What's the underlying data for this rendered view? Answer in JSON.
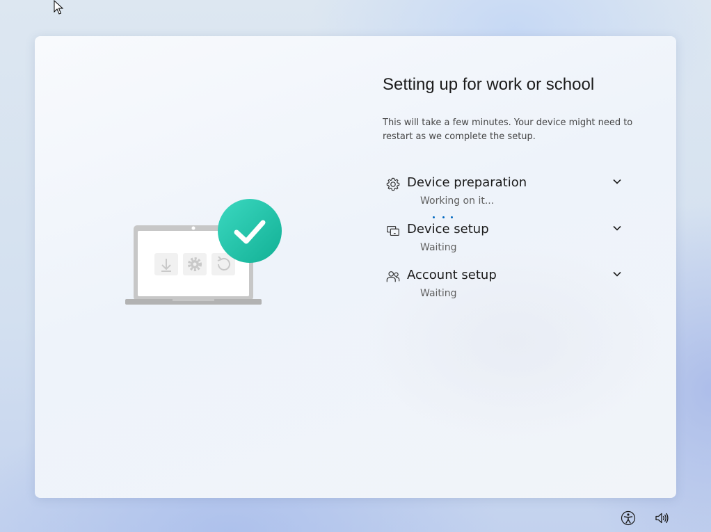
{
  "page": {
    "title": "Setting up for work or school",
    "description": "This will take a few minutes. Your device might need to restart as we complete the setup."
  },
  "steps": [
    {
      "label": "Device preparation",
      "status": "Working on it...",
      "icon": "gear-icon",
      "state": "in-progress"
    },
    {
      "label": "Device setup",
      "status": "Waiting",
      "icon": "devices-icon",
      "state": "waiting"
    },
    {
      "label": "Account setup",
      "status": "Waiting",
      "icon": "people-icon",
      "state": "waiting"
    }
  ],
  "illustration": {
    "laptop_icons": [
      "download-icon",
      "gear-icon",
      "refresh-icon"
    ],
    "badge_icon": "checkmark-icon"
  },
  "tray": {
    "icons": [
      "accessibility-icon",
      "volume-icon"
    ]
  },
  "colors": {
    "accent": "#0067c0",
    "badge": "#20c3a5",
    "title_text": "#1b1b1b",
    "body_text": "#444444",
    "status_text": "#5f5f5f"
  }
}
